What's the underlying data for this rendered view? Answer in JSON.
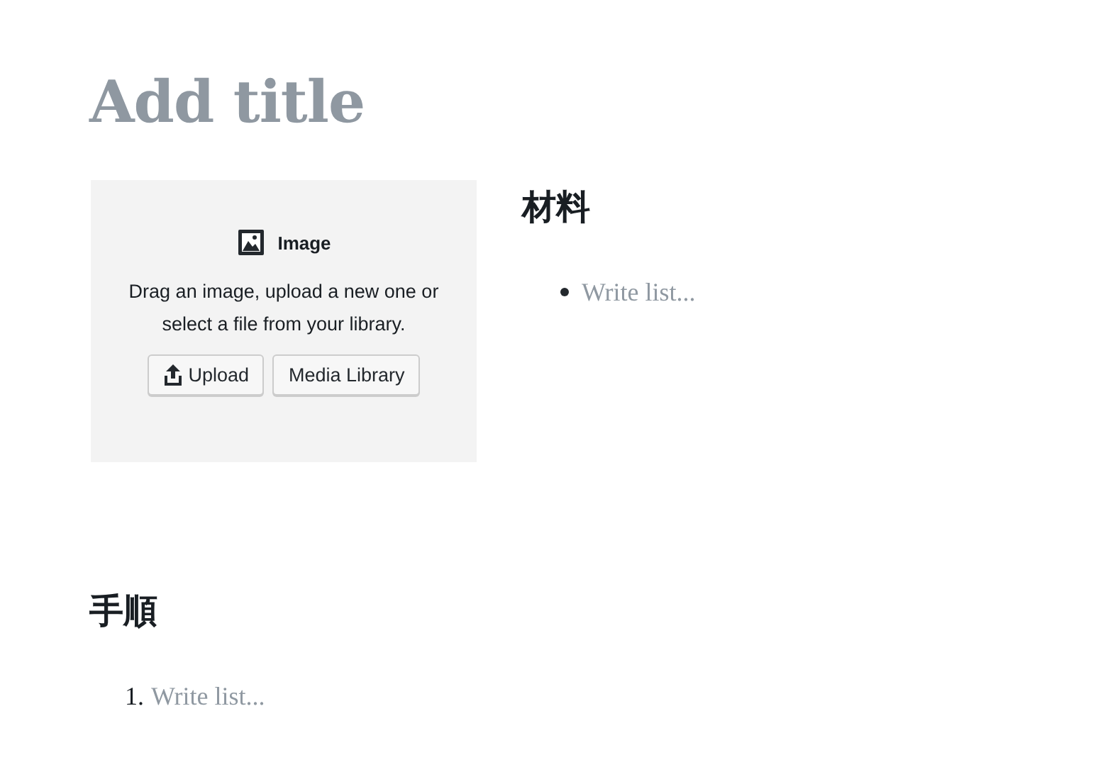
{
  "title": {
    "placeholder": "Add title"
  },
  "columns": [
    {
      "kind": "image",
      "label": "Image",
      "instructions": "Drag an image, upload a new one or select a file from your library.",
      "buttons": [
        {
          "label": "Upload",
          "kind": "upload"
        },
        {
          "label": "Media Library",
          "kind": "plain"
        }
      ]
    },
    {
      "kind": "section",
      "heading": "材料",
      "list": {
        "ordered": false,
        "items": [
          {
            "placeholder": "Write list..."
          }
        ]
      }
    }
  ],
  "section": {
    "heading": "手順",
    "list": {
      "ordered": true,
      "items": [
        {
          "marker": "1.",
          "placeholder": "Write list..."
        }
      ]
    }
  }
}
